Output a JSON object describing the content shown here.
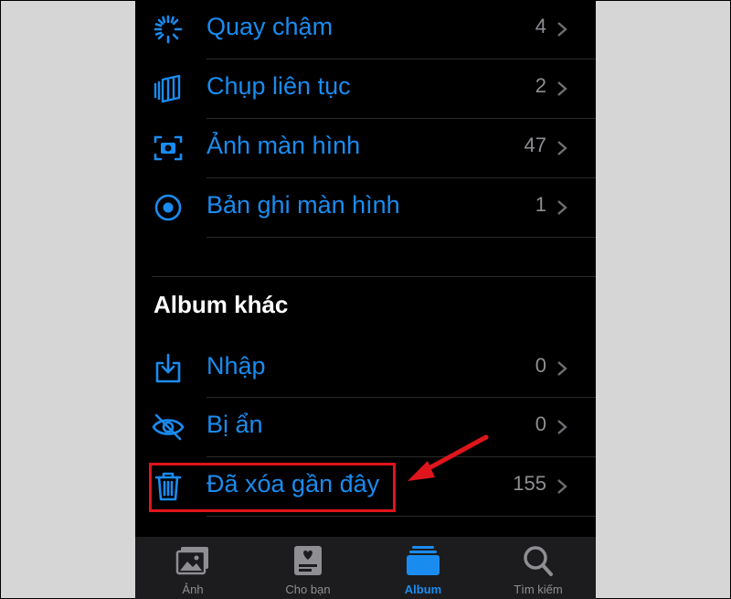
{
  "colors": {
    "accent": "#1a8cf0",
    "muted": "#8e8e93",
    "highlight": "#e0151b"
  },
  "media_types": [
    {
      "label": "Quay chậm",
      "count": "4",
      "icon": "slow-motion-icon"
    },
    {
      "label": "Chụp liên tục",
      "count": "2",
      "icon": "burst-icon"
    },
    {
      "label": "Ảnh màn hình",
      "count": "47",
      "icon": "screenshot-icon"
    },
    {
      "label": "Bản ghi màn hình",
      "count": "1",
      "icon": "screen-recording-icon"
    }
  ],
  "other_albums": {
    "title": "Album khác",
    "items": [
      {
        "label": "Nhập",
        "count": "0",
        "icon": "import-icon"
      },
      {
        "label": "Bị ẩn",
        "count": "0",
        "icon": "hidden-eye-icon"
      },
      {
        "label": "Đã xóa gần đây",
        "count": "155",
        "icon": "trash-icon"
      }
    ]
  },
  "tabs": [
    {
      "label": "Ảnh",
      "icon": "photos-icon",
      "active": false
    },
    {
      "label": "Cho bạn",
      "icon": "for-you-icon",
      "active": false
    },
    {
      "label": "Album",
      "icon": "albums-icon",
      "active": true
    },
    {
      "label": "Tìm kiếm",
      "icon": "search-icon",
      "active": false
    }
  ]
}
